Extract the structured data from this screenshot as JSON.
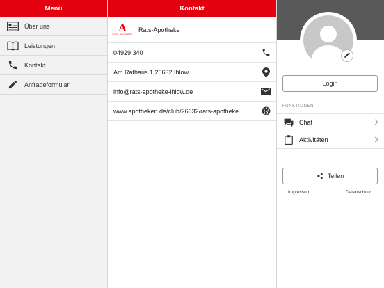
{
  "menu": {
    "title": "Menü",
    "items": [
      {
        "label": "Über uns",
        "icon": "newspaper-icon"
      },
      {
        "label": "Leistungen",
        "icon": "book-icon"
      },
      {
        "label": "Kontakt",
        "icon": "phone-icon"
      },
      {
        "label": "Anfrageformular",
        "icon": "pencil-icon"
      }
    ]
  },
  "contact": {
    "title": "Kontakt",
    "brand_name": "Rats-Apotheke",
    "logo_mark": "A",
    "logo_text": "RATS-APOTHEKE",
    "phone": "04929 340",
    "address": "Am Rathaus 1 26632 Ihlow",
    "email": "info@rats-apotheke-ihlow.de",
    "website": "www.apotheken.de/club/26632/rats-apotheke"
  },
  "profile": {
    "login_label": "Login",
    "section_label": "FUNKTIONEN",
    "functions": [
      {
        "label": "Chat",
        "icon": "chat-icon"
      },
      {
        "label": "Aktivitäten",
        "icon": "clipboard-icon"
      }
    ],
    "share_label": "Teilen",
    "imprint_label": "Impressum",
    "privacy_label": "Datenschutz"
  },
  "colors": {
    "accent": "#e3000f",
    "cover": "#595959",
    "panel_bg": "#f2f2f2"
  }
}
